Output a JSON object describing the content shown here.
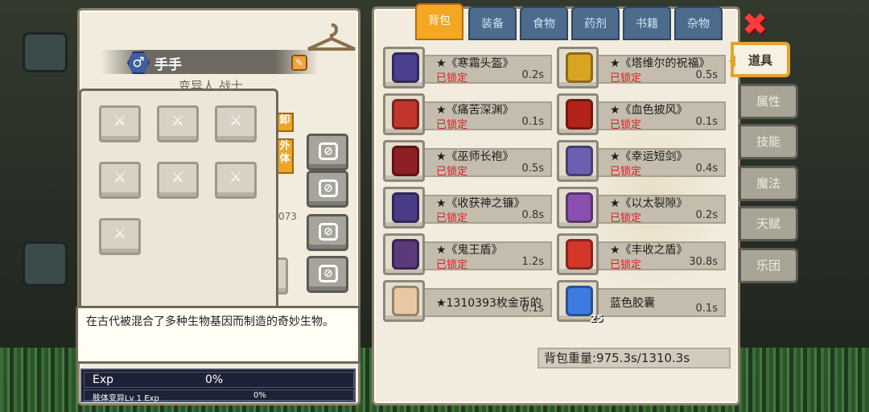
{
  "character": {
    "gender_symbol": "♂",
    "name": "手手",
    "subtitle": "变异人 战士",
    "side_tag_1": "卸",
    "side_tag_2": "外体",
    "stat_fragment": "073",
    "description": "在古代被混合了多种生物基因而制造的奇妙生物。",
    "exp_label": "Exp",
    "exp_percent": "0%",
    "limb_label": "肢体变异Lv 1 Exp",
    "limb_percent": "0%"
  },
  "top_tabs": [
    {
      "label": "背包",
      "active": true
    },
    {
      "label": "装备",
      "active": false
    },
    {
      "label": "食物",
      "active": false
    },
    {
      "label": "药剂",
      "active": false
    },
    {
      "label": "书籍",
      "active": false
    },
    {
      "label": "杂物",
      "active": false
    }
  ],
  "side_tabs": [
    {
      "label": "道具",
      "active": true
    },
    {
      "label": "属性",
      "active": false
    },
    {
      "label": "技能",
      "active": false
    },
    {
      "label": "魔法",
      "active": false
    },
    {
      "label": "天赋",
      "active": false
    },
    {
      "label": "乐团",
      "active": false
    }
  ],
  "items": [
    {
      "name": "★《寒霜头盔》",
      "lock": "已锁定",
      "weight": "0.2s",
      "icon": "frost-helmet-icon",
      "color": "#4b3f8f",
      "count": ""
    },
    {
      "name": "★《塔维尔的祝福》",
      "lock": "已锁定",
      "weight": "0.5s",
      "icon": "blessing-ring-icon",
      "color": "#d8a422",
      "count": ""
    },
    {
      "name": "★《痛苦深渊》",
      "lock": "已锁定",
      "weight": "0.1s",
      "icon": "abyss-amulet-icon",
      "color": "#c0362c",
      "count": ""
    },
    {
      "name": "★《血色披风》",
      "lock": "已锁定",
      "weight": "0.1s",
      "icon": "blood-cloak-icon",
      "color": "#b3231b",
      "count": ""
    },
    {
      "name": "★《巫师长袍》",
      "lock": "已锁定",
      "weight": "0.5s",
      "icon": "wizard-robe-icon",
      "color": "#8e1f24",
      "count": ""
    },
    {
      "name": "★《幸运短剑》",
      "lock": "已锁定",
      "weight": "0.4s",
      "icon": "lucky-dagger-icon",
      "color": "#6d5fb0",
      "count": ""
    },
    {
      "name": "★《收获神之镰》",
      "lock": "已锁定",
      "weight": "0.8s",
      "icon": "harvest-scythe-icon",
      "color": "#4a3c85",
      "count": ""
    },
    {
      "name": "★《以太裂隙》",
      "lock": "已锁定",
      "weight": "0.2s",
      "icon": "ether-rift-icon",
      "color": "#8a4fb0",
      "count": ""
    },
    {
      "name": "★《鬼王盾》",
      "lock": "已锁定",
      "weight": "1.2s",
      "icon": "ghost-shield-icon",
      "color": "#5a3a7a",
      "count": ""
    },
    {
      "name": "★《丰收之盾》",
      "lock": "已锁定",
      "weight": "30.8s",
      "icon": "harvest-shield-icon",
      "color": "#d4362a",
      "count": ""
    },
    {
      "name": "★1310393枚金币的",
      "lock": "",
      "weight": "0.1s",
      "icon": "gold-coin-card-icon",
      "color": "#e8c9a4",
      "count": ""
    },
    {
      "name": "蓝色胶囊",
      "lock": "",
      "weight": "0.1s",
      "icon": "blue-capsule-icon",
      "color": "#3e7be0",
      "count": "25"
    }
  ],
  "bag_weight": "背包重量:975.3s/1310.3s",
  "close_symbol": "✖"
}
